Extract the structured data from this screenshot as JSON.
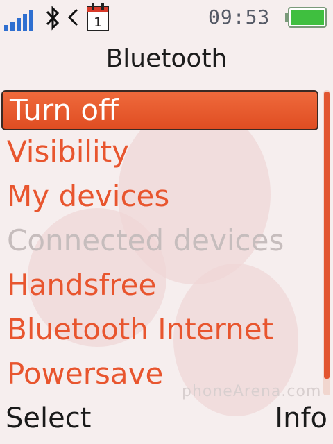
{
  "status_bar": {
    "time": "09:53",
    "signal_icon": "signal-strength-icon",
    "bluetooth_icon": "bluetooth-icon",
    "arrow_icon": "arrow-left-icon",
    "calendar_icon": "calendar-icon",
    "battery_icon": "battery-icon",
    "battery_level": 1.0,
    "accent_color": "#2f6fd0",
    "battery_color": "#3fbf3f"
  },
  "title": "Bluetooth",
  "menu": {
    "items": [
      {
        "label": "Turn off",
        "state": "selected"
      },
      {
        "label": "Visibility",
        "state": "enabled"
      },
      {
        "label": "My devices",
        "state": "enabled"
      },
      {
        "label": "Connected devices",
        "state": "disabled"
      },
      {
        "label": "Handsfree",
        "state": "enabled"
      },
      {
        "label": "Bluetooth Internet",
        "state": "enabled"
      },
      {
        "label": "Powersave",
        "state": "enabled"
      }
    ],
    "item_color": "#e8552e",
    "disabled_color": "#c6bdbd"
  },
  "softkeys": {
    "left": "Select",
    "right": "Info"
  }
}
